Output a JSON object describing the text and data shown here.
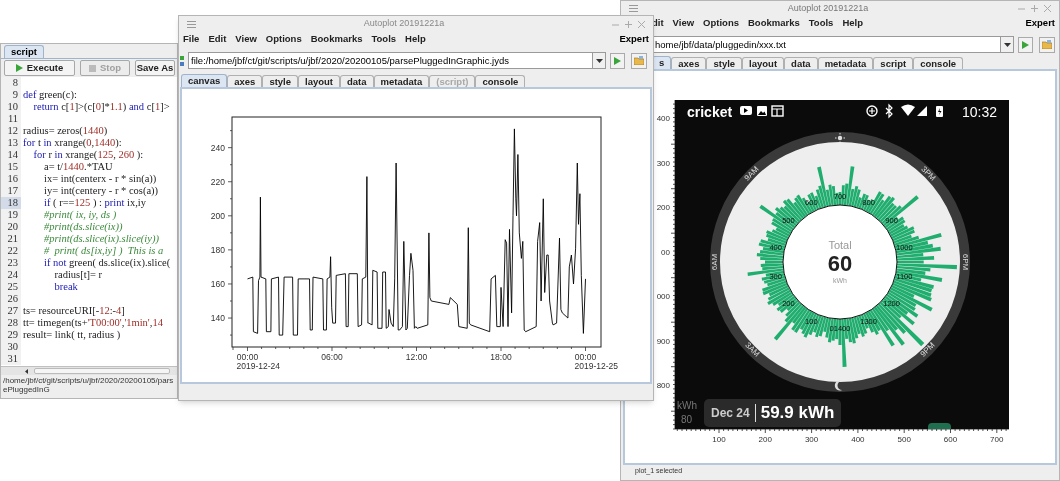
{
  "script_window": {
    "tabs": [
      {
        "label": "script",
        "selected": true
      }
    ],
    "buttons": [
      {
        "label": "Execute",
        "kind": "run",
        "disabled": false
      },
      {
        "label": "Stop",
        "kind": "stop",
        "disabled": true
      },
      {
        "label": "Save As",
        "kind": "plain",
        "disabled": false
      }
    ],
    "lines": [
      {
        "number": "8",
        "current": false
      },
      {
        "number": "9",
        "text": "def green(c):",
        "current": false
      },
      {
        "number": "10",
        "text": "    return c[1]>(c[0]*1.1) and c[1]>",
        "current": false
      },
      {
        "number": "11",
        "current": false
      },
      {
        "number": "12",
        "text": "radius= zeros(1440)",
        "current": false
      },
      {
        "number": "13",
        "text": "for t in xrange(0,1440):",
        "current": false
      },
      {
        "number": "14",
        "text": "    for r in xrange(125, 260 ):",
        "current": false
      },
      {
        "number": "15",
        "text": "        a= t/1440.*TAU",
        "current": false
      },
      {
        "number": "16",
        "text": "        ix= int(centerx - r * sin(a))",
        "current": false
      },
      {
        "number": "17",
        "text": "        iy= int(centery - r * cos(a))",
        "current": false
      },
      {
        "number": "18",
        "text": "        if ( r==125 ) : print ix,iy",
        "current": true
      },
      {
        "number": "19",
        "text": "        #print( ix, iy, ds )",
        "current": false
      },
      {
        "number": "20",
        "text": "        #print(ds.slice(ix))",
        "current": false
      },
      {
        "number": "21",
        "text": "        #print(ds.slice(ix).slice(iy))",
        "current": false
      },
      {
        "number": "22",
        "text": "        #  print( ds[ix,iy] )  This is a",
        "current": false
      },
      {
        "number": "23",
        "text": "        if not green( ds.slice(ix).slice(",
        "current": false
      },
      {
        "number": "24",
        "text": "            radius[t]= r",
        "current": false
      },
      {
        "number": "25",
        "text": "            break",
        "current": false
      },
      {
        "number": "26",
        "current": false
      },
      {
        "number": "27",
        "text": "ts= resourceURI[-12:-4]",
        "current": false
      },
      {
        "number": "28",
        "text": "tt= timegen(ts+'T00:00','1min',14",
        "current": false
      },
      {
        "number": "29",
        "text": "result= link( tt, radius )",
        "current": false
      },
      {
        "number": "30",
        "current": false
      },
      {
        "number": "31",
        "current": false
      }
    ],
    "status": "/home/jbf/ct/git/scripts/u/jbf/2020/20200105/parsePluggedInG"
  },
  "plot_window": {
    "title": "Autoplot 20191221a",
    "menu": [
      "File",
      "Edit",
      "View",
      "Options",
      "Bookmarks",
      "Tools",
      "Help"
    ],
    "expert": "Expert",
    "url": "file:/home/jbf/ct/git/scripts/u/jbf/2020/20200105/parsePluggedInGraphic.jyds",
    "tabs": [
      {
        "label": "canvas",
        "selected": true,
        "disabled": false
      },
      {
        "label": "axes",
        "selected": false,
        "disabled": false
      },
      {
        "label": "style",
        "selected": false,
        "disabled": false
      },
      {
        "label": "layout",
        "selected": false,
        "disabled": false
      },
      {
        "label": "data",
        "selected": false,
        "disabled": false
      },
      {
        "label": "metadata",
        "selected": false,
        "disabled": false
      },
      {
        "label": "(script)",
        "selected": false,
        "disabled": true
      },
      {
        "label": "console",
        "selected": false,
        "disabled": false
      }
    ],
    "chart_data": {
      "type": "line",
      "x": [
        0,
        0.38,
        0.42,
        0.72,
        0.78,
        0.88,
        0.92,
        0.96,
        1.3,
        1.34,
        1.66,
        1.7,
        2.2,
        2.25,
        2.5,
        2.6,
        3.2,
        3.25,
        3.55,
        3.6,
        4.4,
        4.45,
        4.6,
        4.65,
        5.35,
        5.4,
        5.6,
        5.65,
        5.85,
        5.9,
        5.98,
        6.05,
        6.25,
        6.3,
        6.95,
        7.0,
        7.15,
        7.2,
        7.8,
        7.85,
        8.1,
        8.15,
        8.4,
        8.48,
        8.55,
        8.6,
        8.85,
        8.9,
        9.2,
        9.25,
        9.55,
        9.6,
        9.8,
        9.85,
        10.0,
        10.05,
        10.2,
        10.35,
        10.45,
        10.55,
        10.7,
        10.8,
        11.0,
        11.1,
        11.25,
        11.35,
        11.5,
        11.6,
        11.75,
        11.85,
        11.95,
        12.05,
        12.8,
        12.88,
        12.95,
        13.05,
        14.3,
        14.4,
        14.9,
        15.0,
        15.6,
        15.68,
        15.75,
        15.85,
        17.2,
        17.3,
        17.6,
        17.7,
        17.95,
        18.0,
        18.15,
        18.3,
        18.4,
        18.5,
        18.6,
        18.75,
        18.85,
        18.95,
        19.05,
        19.1,
        19.2,
        19.3,
        19.45,
        19.55,
        19.65,
        19.75,
        20.5,
        20.6,
        20.75,
        20.85,
        21.0,
        21.1,
        21.25,
        21.35,
        21.45,
        21.65,
        21.7,
        21.95,
        22.15,
        22.25,
        22.35,
        22.75,
        22.85,
        23.0,
        23.15,
        23.3,
        23.42,
        23.5,
        23.6,
        23.7,
        23.85,
        24.0
      ],
      "series": [
        {
          "color": "#000000",
          "values": [
            163,
            164,
            132,
            131,
            162,
            164,
            211,
            164,
            163,
            132,
            132,
            163,
            164,
            130,
            130,
            164,
            164,
            130,
            130,
            163,
            163,
            133,
            133,
            164,
            163,
            133,
            133,
            163,
            164,
            176,
            146,
            137,
            137,
            165,
            166,
            135,
            135,
            166,
            166,
            135,
            136,
            163,
            164,
            223,
            137,
            137,
            136,
            168,
            167,
            134,
            134,
            167,
            167,
            134,
            135,
            145,
            137,
            135,
            163,
            231,
            133,
            133,
            135,
            185,
            133,
            134,
            165,
            178,
            168,
            134,
            135,
            134,
            136,
            190,
            152,
            150,
            148,
            152,
            148,
            135,
            134,
            193,
            137,
            136,
            132,
            163,
            165,
            135,
            135,
            158,
            135,
            186,
            184,
            135,
            192,
            143,
            200,
            251,
            210,
            200,
            236,
            190,
            175,
            185,
            133,
            132,
            135,
            185,
            196,
            150,
            210,
            155,
            177,
            177,
            150,
            137,
            136,
            137,
            187,
            145,
            143,
            140,
            170,
            177,
            160,
            181,
            231,
            195,
            213,
            165,
            131,
            163
          ]
        }
      ],
      "xlim": [
        -1.1,
        25.1
      ],
      "ylim": [
        123,
        258
      ],
      "xticks": [
        {
          "value": 0,
          "label": "00:00"
        },
        {
          "value": 6,
          "label": "06:00"
        },
        {
          "value": 12,
          "label": "12:00"
        },
        {
          "value": 18,
          "label": "18:00"
        },
        {
          "value": 24,
          "label": "00:00"
        }
      ],
      "yticks": [
        140,
        160,
        180,
        200,
        220,
        240
      ],
      "annotations": [
        "2019-12-24",
        "2019-12-25"
      ]
    }
  },
  "image_window": {
    "title": "Autoplot 20191221a",
    "menu": [
      "dit",
      "View",
      "Options",
      "Bookmarks",
      "Tools",
      "Help"
    ],
    "expert": "Expert",
    "url": "home/jbf/data/pluggedin/xxx.txt",
    "tabs": [
      {
        "label": "s",
        "selected": true
      },
      {
        "label": "axes",
        "selected": false
      },
      {
        "label": "style",
        "selected": false
      },
      {
        "label": "layout",
        "selected": false
      },
      {
        "label": "data",
        "selected": false
      },
      {
        "label": "metadata",
        "selected": false
      },
      {
        "label": "script",
        "selected": false
      },
      {
        "label": "console",
        "selected": false
      }
    ],
    "y_tick_labels": [
      "400",
      "300",
      "200",
      "00",
      "000",
      "900",
      "800"
    ],
    "x_tick_labels": [
      "100",
      "200",
      "300",
      "400",
      "500",
      "600",
      "700"
    ],
    "phone": {
      "carrier": "cricket",
      "time": "10:32",
      "hour_labels": [
        "3PM",
        "6PM",
        "9PM",
        "3AM",
        "6AM",
        "9AM"
      ],
      "ring_ticks": [
        "01400",
        "100",
        "200",
        "300",
        "400",
        "500",
        "600",
        "700",
        "800",
        "900",
        "1000",
        "1100",
        "1200",
        "1300"
      ],
      "total_label": "Total",
      "total_value": "60",
      "total_unit": "kWh",
      "scale_unit": "kWh",
      "scale_value": "80",
      "day": "Dec 24",
      "day_total": "59.9 kWh"
    },
    "status": "plot_1 selected"
  }
}
